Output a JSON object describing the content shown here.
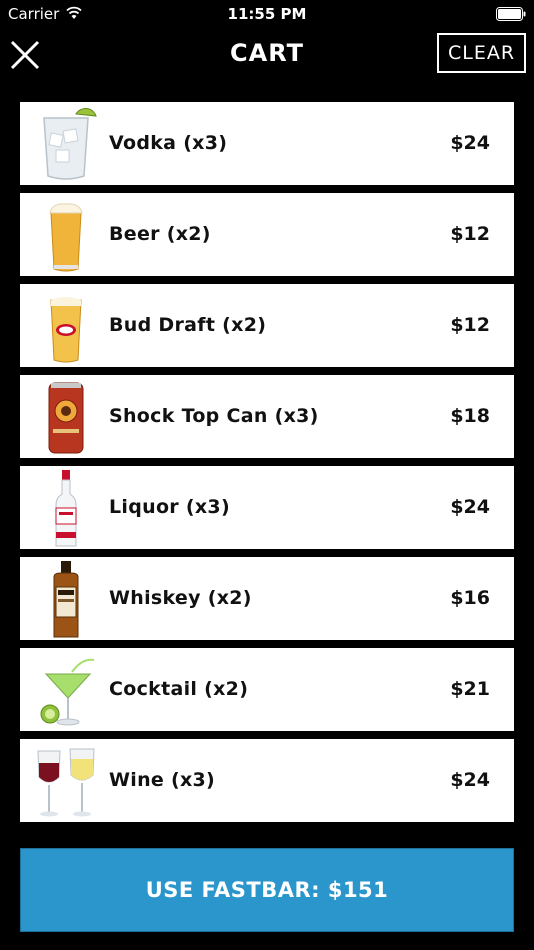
{
  "status_bar": {
    "carrier": "Carrier",
    "time": "11:55 PM"
  },
  "header": {
    "title": "CART",
    "clear_label": "CLEAR"
  },
  "cart": {
    "items": [
      {
        "name": "Vodka (x3)",
        "price": "$24",
        "icon": "vodka-glass-icon"
      },
      {
        "name": "Beer (x2)",
        "price": "$12",
        "icon": "beer-glass-icon"
      },
      {
        "name": "Bud Draft (x2)",
        "price": "$12",
        "icon": "bud-draft-glass-icon"
      },
      {
        "name": "Shock Top Can (x3)",
        "price": "$18",
        "icon": "shock-top-can-icon"
      },
      {
        "name": "Liquor (x3)",
        "price": "$24",
        "icon": "liquor-bottle-icon"
      },
      {
        "name": "Whiskey (x2)",
        "price": "$16",
        "icon": "whiskey-bottle-icon"
      },
      {
        "name": "Cocktail (x2)",
        "price": "$21",
        "icon": "cocktail-glass-icon"
      },
      {
        "name": "Wine (x3)",
        "price": "$24",
        "icon": "wine-glasses-icon"
      }
    ]
  },
  "checkout": {
    "label": "USE FASTBAR: $151"
  }
}
